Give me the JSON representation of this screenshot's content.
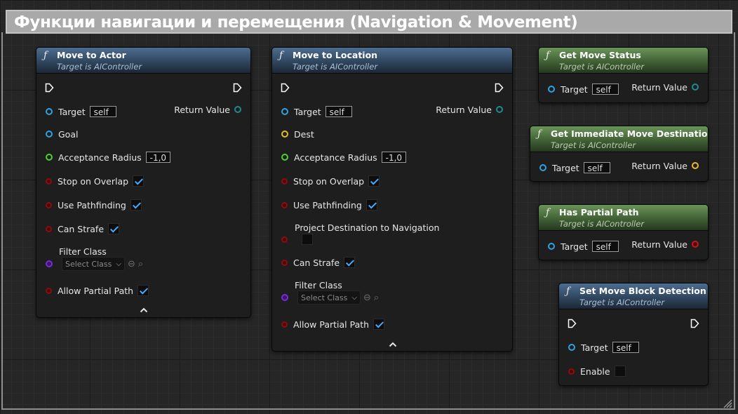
{
  "comment": {
    "title": "Функции навигации и перемещения (Navigation & Movement)"
  },
  "nodes": {
    "move_to_actor": {
      "title": "Move to Actor",
      "subtitle": "Target is AIController",
      "target_label": "Target",
      "target_value": "self",
      "return_label": "Return Value",
      "goal_label": "Goal",
      "acceptance_label": "Acceptance Radius",
      "acceptance_value": "-1,0",
      "stop_overlap_label": "Stop on Overlap",
      "stop_overlap_checked": true,
      "use_pathfinding_label": "Use Pathfinding",
      "use_pathfinding_checked": true,
      "can_strafe_label": "Can Strafe",
      "can_strafe_checked": true,
      "filter_class_label": "Filter Class",
      "filter_class_value": "Select Class",
      "allow_partial_label": "Allow Partial Path",
      "allow_partial_checked": true
    },
    "move_to_location": {
      "title": "Move to Location",
      "subtitle": "Target is AIController",
      "target_label": "Target",
      "target_value": "self",
      "return_label": "Return Value",
      "dest_label": "Dest",
      "acceptance_label": "Acceptance Radius",
      "acceptance_value": "-1,0",
      "stop_overlap_label": "Stop on Overlap",
      "stop_overlap_checked": true,
      "use_pathfinding_label": "Use Pathfinding",
      "use_pathfinding_checked": true,
      "project_dest_label": "Project Destination to Navigation",
      "project_dest_checked": false,
      "can_strafe_label": "Can Strafe",
      "can_strafe_checked": true,
      "filter_class_label": "Filter Class",
      "filter_class_value": "Select Class",
      "allow_partial_label": "Allow Partial Path",
      "allow_partial_checked": true
    },
    "get_move_status": {
      "title": "Get Move Status",
      "subtitle": "Target is AIController",
      "target_label": "Target",
      "target_value": "self",
      "return_label": "Return Value"
    },
    "get_immediate_move_destination": {
      "title": "Get Immediate Move Destination",
      "subtitle": "Target is AIController",
      "target_label": "Target",
      "target_value": "self",
      "return_label": "Return Value"
    },
    "has_partial_path": {
      "title": "Has Partial Path",
      "subtitle": "Target is AIController",
      "target_label": "Target",
      "target_value": "self",
      "return_label": "Return Value"
    },
    "set_move_block_detection": {
      "title": "Set Move Block Detection",
      "subtitle": "Target is AIController",
      "target_label": "Target",
      "target_value": "self",
      "enable_label": "Enable",
      "enable_checked": false
    }
  },
  "icons": {
    "function": "function-icon",
    "exec": "exec-pin-icon",
    "collapse": "chevron-up-icon",
    "use_selected": "arrow-left-circle-icon",
    "browse": "magnifier-icon"
  },
  "colors": {
    "pure_header": "#4d6d8f",
    "pure_green_header": "#6a9458",
    "object_pin": "#2fa2e0",
    "vector_pin": "#e8ba2a",
    "float_pin": "#4cd22c",
    "bool_pin": "#8a0e0e",
    "class_pin": "#7a2ad6",
    "check": "#4aa8ff"
  }
}
